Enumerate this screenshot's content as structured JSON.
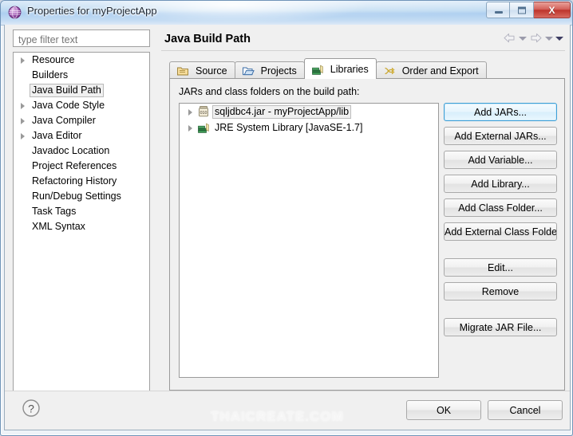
{
  "window": {
    "title": "Properties for myProjectApp",
    "icon": "eclipse-properties-icon",
    "buttons": {
      "minimize": "minimize-button",
      "maximize": "maximize-button",
      "close_glyph": "X"
    }
  },
  "filter": {
    "placeholder": "type filter text",
    "value": ""
  },
  "sidebar": {
    "items": [
      {
        "label": "Resource",
        "expandable": true,
        "selected": false
      },
      {
        "label": "Builders",
        "expandable": false,
        "selected": false
      },
      {
        "label": "Java Build Path",
        "expandable": false,
        "selected": true
      },
      {
        "label": "Java Code Style",
        "expandable": true,
        "selected": false
      },
      {
        "label": "Java Compiler",
        "expandable": true,
        "selected": false
      },
      {
        "label": "Java Editor",
        "expandable": true,
        "selected": false
      },
      {
        "label": "Javadoc Location",
        "expandable": false,
        "selected": false
      },
      {
        "label": "Project References",
        "expandable": false,
        "selected": false
      },
      {
        "label": "Refactoring History",
        "expandable": false,
        "selected": false
      },
      {
        "label": "Run/Debug Settings",
        "expandable": false,
        "selected": false
      },
      {
        "label": "Task Tags",
        "expandable": false,
        "selected": false
      },
      {
        "label": "XML Syntax",
        "expandable": false,
        "selected": false
      }
    ]
  },
  "page": {
    "title": "Java Build Path",
    "nav": {
      "back": "back-arrow-icon",
      "back_menu": "back-dropdown-icon",
      "forward": "forward-arrow-icon",
      "forward_menu": "forward-dropdown-icon",
      "menu": "view-menu-icon"
    }
  },
  "tabs": [
    {
      "label": "Source",
      "icon": "source-folder-icon",
      "active": false
    },
    {
      "label": "Projects",
      "icon": "projects-folder-icon",
      "active": false
    },
    {
      "label": "Libraries",
      "icon": "libraries-books-icon",
      "active": true
    },
    {
      "label": "Order and Export",
      "icon": "order-export-icon",
      "active": false
    }
  ],
  "libraries": {
    "heading": "JARs and class folders on the build path:",
    "entries": [
      {
        "label": "sqljdbc4.jar - myProjectApp/lib",
        "icon": "jar-icon",
        "expandable": true,
        "selected": true
      },
      {
        "label": "JRE System Library [JavaSE-1.7]",
        "icon": "jre-library-icon",
        "expandable": true,
        "selected": false
      }
    ],
    "buttons": [
      {
        "label": "Add JARs...",
        "name": "add-jars-button",
        "focused": true,
        "spacing": "normal"
      },
      {
        "label": "Add External JARs...",
        "name": "add-external-jars-button",
        "focused": false,
        "spacing": "normal"
      },
      {
        "label": "Add Variable...",
        "name": "add-variable-button",
        "focused": false,
        "spacing": "normal"
      },
      {
        "label": "Add Library...",
        "name": "add-library-button",
        "focused": false,
        "spacing": "normal"
      },
      {
        "label": "Add Class Folder...",
        "name": "add-class-folder-button",
        "focused": false,
        "spacing": "normal"
      },
      {
        "label": "Add External Class Folder...",
        "name": "add-external-class-folder-button",
        "focused": false,
        "spacing": "large"
      },
      {
        "label": "Edit...",
        "name": "edit-button",
        "focused": false,
        "spacing": "normal"
      },
      {
        "label": "Remove",
        "name": "remove-button",
        "focused": false,
        "spacing": "large"
      },
      {
        "label": "Migrate JAR File...",
        "name": "migrate-jar-file-button",
        "focused": false,
        "spacing": "normal"
      }
    ]
  },
  "footer": {
    "help": "help-icon",
    "ok_label": "OK",
    "cancel_label": "Cancel"
  },
  "watermark": "THAICREATE.COM",
  "colors": {
    "accent": "#3c9fd6",
    "titlebar": "#aecff0",
    "close": "#bd342c",
    "dialog_bg": "#f0f0f0"
  }
}
